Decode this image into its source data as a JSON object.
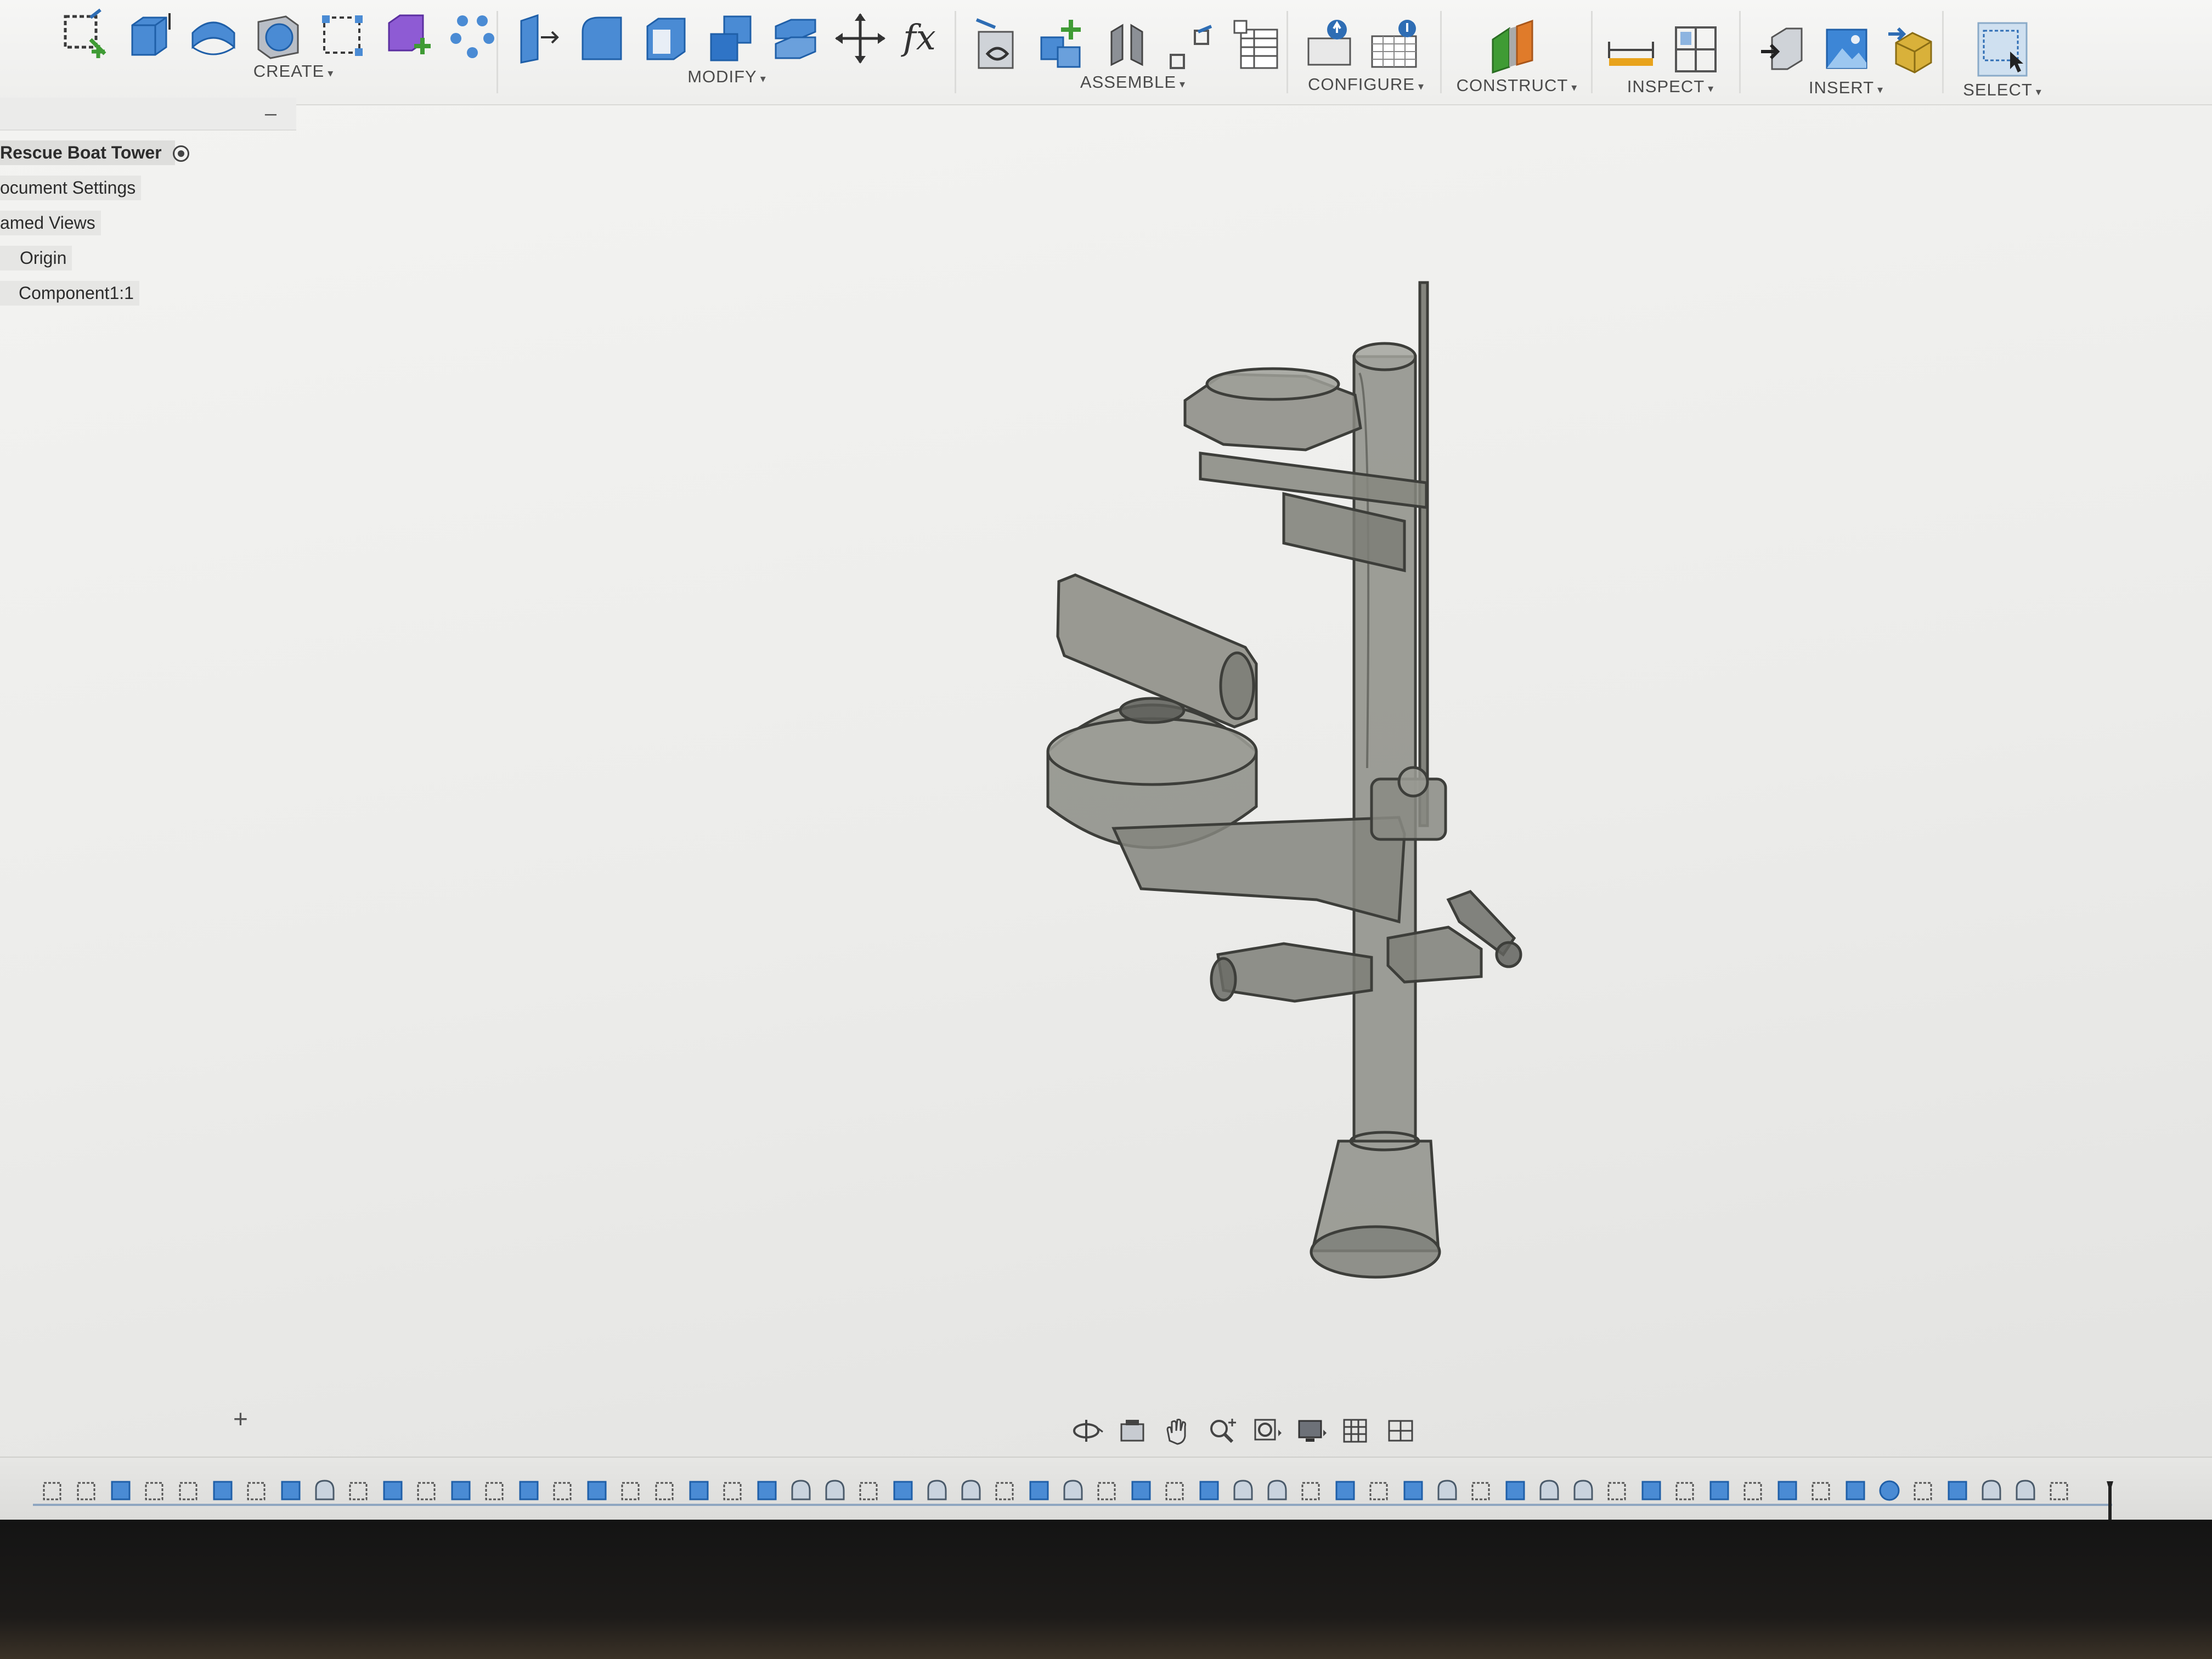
{
  "toolbar": {
    "groups": [
      {
        "label": "CREATE",
        "icons": [
          "create-sketch-icon",
          "extrude-icon",
          "revolve-icon",
          "sweep-icon",
          "rectangular-pattern-icon",
          "new-component-icon",
          "pattern-points-icon"
        ]
      },
      {
        "label": "MODIFY",
        "icons": [
          "press-pull-icon",
          "fillet-icon",
          "shell-icon",
          "combine-icon",
          "split-body-icon",
          "move-icon",
          "parameters-fx-icon"
        ]
      },
      {
        "label": "ASSEMBLE",
        "icons": [
          "joint-icon",
          "new-component-plus-icon",
          "as-built-joint-icon",
          "joint-origin-icon",
          "bill-of-materials-icon"
        ]
      },
      {
        "label": "CONFIGURE",
        "icons": [
          "configure-table-icon",
          "configure-grid-icon"
        ]
      },
      {
        "label": "CONSTRUCT",
        "icons": [
          "offset-plane-icon"
        ]
      },
      {
        "label": "INSPECT",
        "icons": [
          "measure-icon",
          "interference-icon"
        ]
      },
      {
        "label": "INSERT",
        "icons": [
          "insert-derive-icon",
          "insert-canvas-icon",
          "insert-mesh-icon"
        ]
      },
      {
        "label": "SELECT",
        "icons": [
          "window-select-icon"
        ]
      }
    ]
  },
  "browser": {
    "collapse_symbol": "–",
    "root_label": "Rescue Boat Tower",
    "items": [
      "ocument Settings",
      "amed Views",
      "Origin",
      "Component1:1"
    ]
  },
  "comments": {
    "add_symbol": "+"
  },
  "navbar": {
    "icons": [
      "orbit-icon",
      "look-at-icon",
      "pan-icon",
      "zoom-icon",
      "fit-icon",
      "display-settings-icon",
      "grid-icon",
      "viewports-icon"
    ]
  },
  "timeline": {
    "features": [
      "sketch",
      "sketch",
      "extrude",
      "sketch",
      "sketch",
      "extrude",
      "sketch",
      "extrude",
      "revolve",
      "sketch",
      "extrude",
      "sketch",
      "extrude",
      "sketch",
      "extrude",
      "sketch",
      "extrude",
      "sketch",
      "sketch",
      "extrude",
      "sketch",
      "extrude",
      "revolve",
      "revolve",
      "sketch",
      "extrude",
      "revolve",
      "revolve",
      "sketch",
      "extrude",
      "revolve",
      "sketch",
      "extrude",
      "sketch",
      "extrude",
      "revolve",
      "revolve",
      "sketch",
      "extrude",
      "sketch",
      "extrude",
      "revolve",
      "sketch",
      "extrude",
      "revolve",
      "revolve",
      "sketch",
      "extrude",
      "sketch",
      "extrude",
      "sketch",
      "extrude",
      "sketch",
      "extrude",
      "sphere",
      "sketch",
      "extrude",
      "revolve",
      "revolve",
      "sketch"
    ]
  },
  "colors": {
    "model_fill": "#8a8b84",
    "model_edge": "#3d3e3a",
    "background": "#efefed",
    "label_text": "#4a4a4a"
  }
}
